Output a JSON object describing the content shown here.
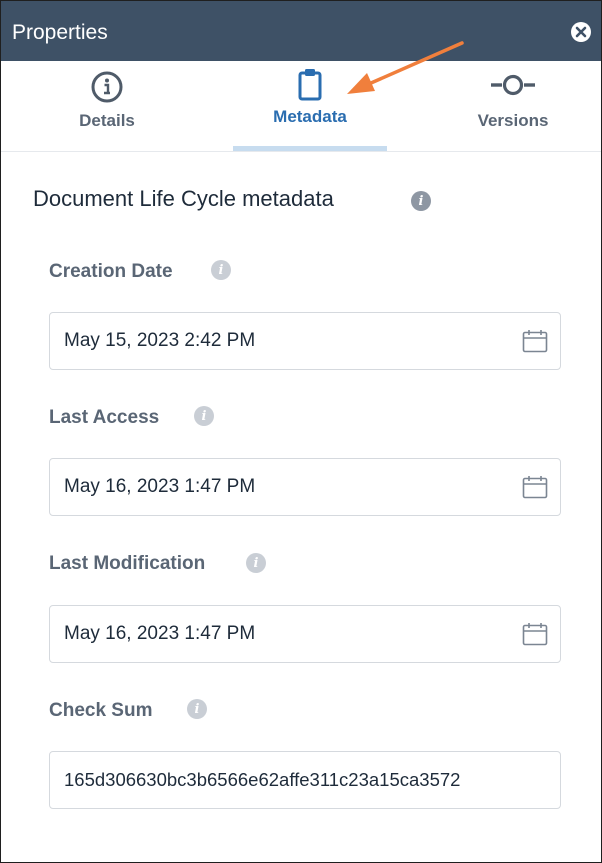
{
  "window": {
    "title": "Properties"
  },
  "tabs": [
    {
      "label": "Details",
      "icon": "info-circle-icon"
    },
    {
      "label": "Metadata",
      "icon": "clipboard-icon",
      "active": true
    },
    {
      "label": "Versions",
      "icon": "commit-icon"
    }
  ],
  "section": {
    "title": "Document Life Cycle metadata"
  },
  "fields": [
    {
      "label": "Creation Date",
      "value": "May 15, 2023 2:42 PM",
      "icon": "calendar-icon"
    },
    {
      "label": "Last Access",
      "value": "May 16, 2023 1:47 PM",
      "icon": "calendar-icon"
    },
    {
      "label": "Last Modification",
      "value": "May 16, 2023 1:47 PM",
      "icon": "calendar-icon"
    },
    {
      "label": "Check Sum",
      "value": "165d306630bc3b6566e62affe311c23a15ca3572"
    }
  ],
  "colors": {
    "titlebar": "#3e5166",
    "active_tab": "#2a6db0",
    "active_underline": "#c7dcef",
    "annotation_arrow": "#f07f3c"
  }
}
